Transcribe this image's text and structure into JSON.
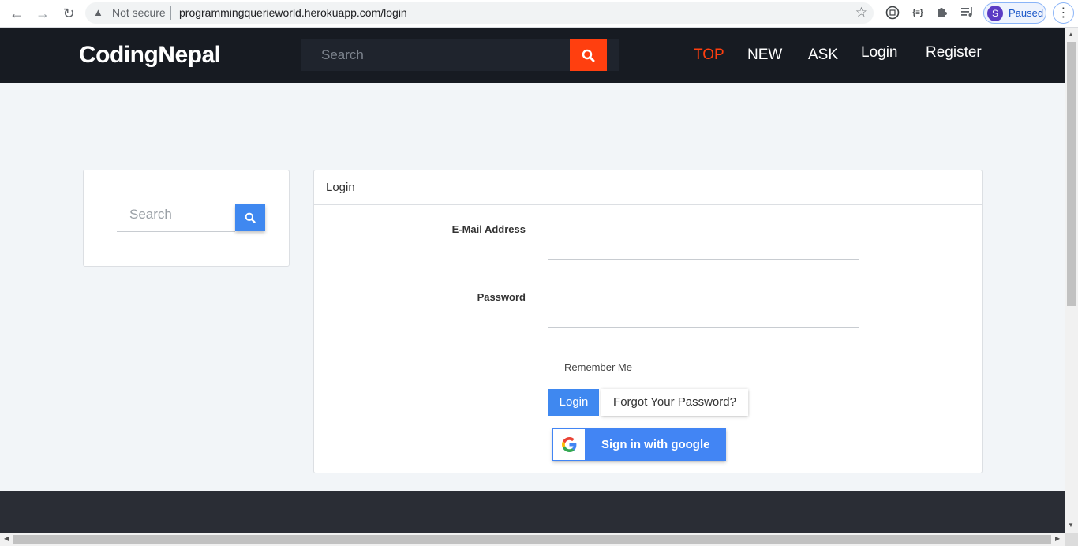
{
  "browser": {
    "security_label": "Not secure",
    "url": "programmingquerieworld.herokuapp.com/login",
    "profile_initial": "S",
    "profile_status": "Paused",
    "extensions": [
      "qr-ext-icon",
      "code-ext-icon",
      "puzzle-icon",
      "media-list-icon"
    ],
    "ext_code_label": "{≡}"
  },
  "header": {
    "logo": "CodingNepal",
    "search_placeholder": "Search",
    "nav": [
      {
        "label": "TOP",
        "active": true
      },
      {
        "label": "NEW"
      },
      {
        "label": "ASK"
      },
      {
        "label": "Login"
      },
      {
        "label": "Register"
      }
    ]
  },
  "sidebar": {
    "search_placeholder": "Search"
  },
  "login": {
    "title": "Login",
    "email_label": "E-Mail Address",
    "password_label": "Password",
    "remember_label": "Remember Me",
    "submit_label": "Login",
    "forgot_label": "Forgot Your Password?",
    "google_label": "Sign in with google"
  },
  "colors": {
    "accent": "#ff3f0f",
    "primary": "#3f88f0",
    "header_bg": "#171b22",
    "page_bg": "#f2f5f8"
  }
}
